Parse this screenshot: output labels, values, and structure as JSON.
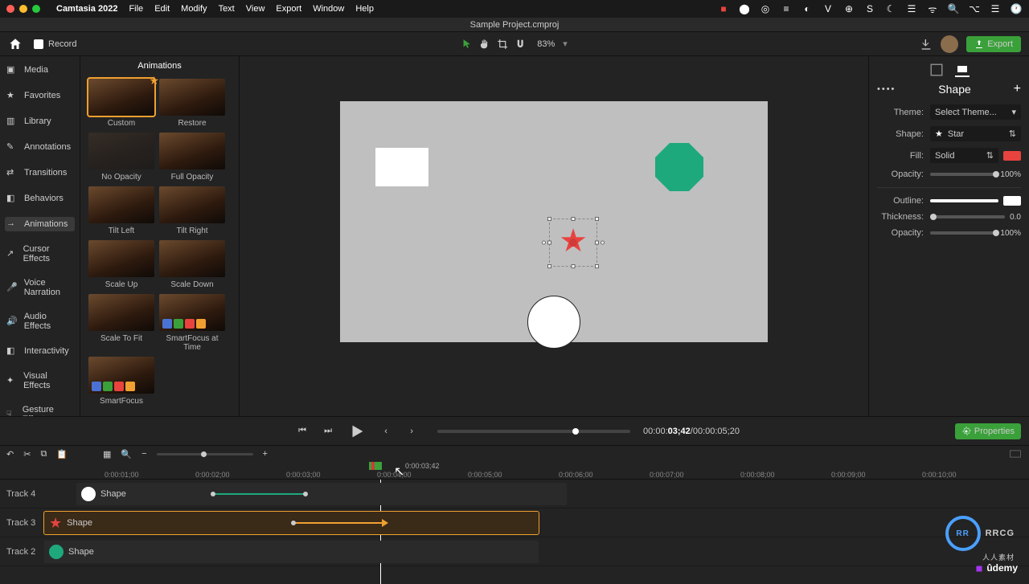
{
  "menubar": {
    "app": "Camtasia 2022",
    "items": [
      "File",
      "Edit",
      "Modify",
      "Text",
      "View",
      "Export",
      "Window",
      "Help"
    ]
  },
  "titlebar": {
    "project": "Sample Project.cmproj"
  },
  "toolbar": {
    "record_label": "Record",
    "zoom": "83%",
    "export_label": "Export"
  },
  "sidebar": {
    "items": [
      {
        "label": "Media"
      },
      {
        "label": "Favorites"
      },
      {
        "label": "Library"
      },
      {
        "label": "Annotations"
      },
      {
        "label": "Transitions"
      },
      {
        "label": "Behaviors"
      },
      {
        "label": "Animations",
        "active": true
      },
      {
        "label": "Cursor Effects"
      },
      {
        "label": "Voice Narration"
      },
      {
        "label": "Audio Effects"
      },
      {
        "label": "Interactivity"
      },
      {
        "label": "Visual Effects"
      },
      {
        "label": "Gesture Effects"
      }
    ]
  },
  "anim_panel": {
    "header": "Animations",
    "tiles": [
      {
        "label": "Custom",
        "selected": true
      },
      {
        "label": "Restore"
      },
      {
        "label": "No Opacity",
        "dim": true
      },
      {
        "label": "Full Opacity"
      },
      {
        "label": "Tilt Left"
      },
      {
        "label": "Tilt Right"
      },
      {
        "label": "Scale Up"
      },
      {
        "label": "Scale Down"
      },
      {
        "label": "Scale To Fit"
      },
      {
        "label": "SmartFocus at Time",
        "sf": true
      },
      {
        "label": "SmartFocus",
        "sf": true
      }
    ]
  },
  "props": {
    "title": "Shape",
    "theme_label": "Theme:",
    "theme_value": "Select Theme...",
    "shape_label": "Shape:",
    "shape_value": "Star",
    "fill_label": "Fill:",
    "fill_value": "Solid",
    "fill_color": "#e8433f",
    "opacity_label": "Opacity:",
    "opacity_value": "100%",
    "outline_label": "Outline:",
    "outline_color": "#ffffff",
    "thickness_label": "Thickness:",
    "thickness_value": "0.0",
    "outline_opacity_label": "Opacity:",
    "outline_opacity_value": "100%"
  },
  "playback": {
    "time_prefix": "00:00:",
    "time_current": "03;42",
    "time_total": "/00:00:05;20",
    "properties_btn": "Properties"
  },
  "ruler": {
    "playhead_time": "0:00:03;42",
    "ticks": [
      "0:00:01;00",
      "0:00:02;00",
      "0:00:03;00",
      "0:00:04;00",
      "0:00:05;00",
      "0:00:06;00",
      "0:00:07;00",
      "0:00:08;00",
      "0:00:09;00",
      "0:00:10;00"
    ]
  },
  "tracks": [
    {
      "name": "Track 4",
      "clip_label": "Shape",
      "icon": "circle"
    },
    {
      "name": "Track 3",
      "clip_label": "Shape",
      "icon": "star",
      "selected": true
    },
    {
      "name": "Track 2",
      "clip_label": "Shape",
      "icon": "oct"
    }
  ],
  "watermark": {
    "text": "RRCG",
    "sub": "人人素材"
  },
  "udemy": "ûdemy"
}
